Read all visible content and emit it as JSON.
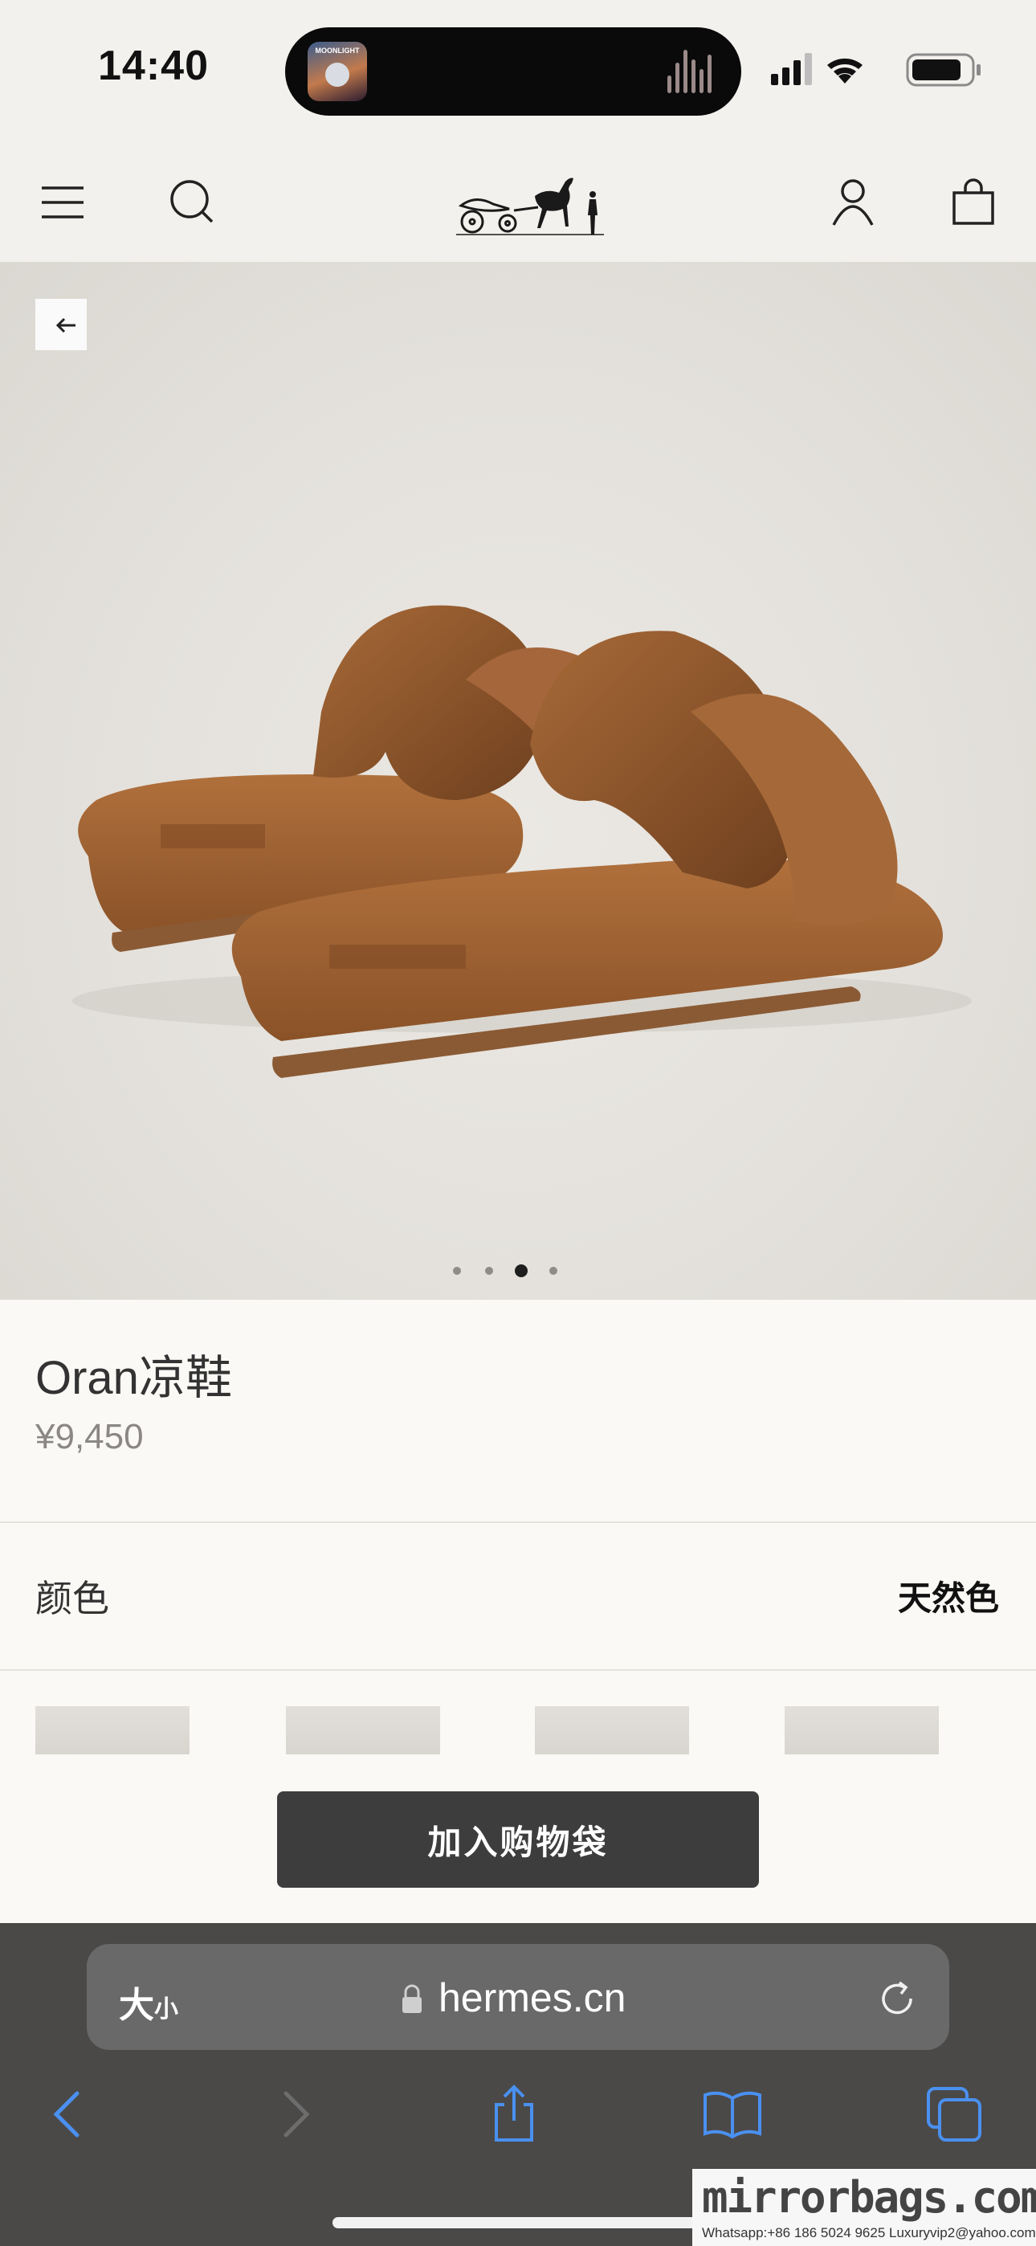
{
  "status_bar": {
    "time": "14:40",
    "now_playing_art_text": "MOONLIGHT"
  },
  "nav": {
    "menu_icon": "hamburger-menu-icon",
    "search_icon": "search-icon",
    "logo": "hermes-carriage-logo",
    "account_icon": "account-icon",
    "bag_icon": "shopping-bag-icon"
  },
  "gallery": {
    "back_icon": "arrow-left-icon",
    "image_count": 4,
    "active_index": 2
  },
  "product": {
    "name": "Oran凉鞋",
    "price": "¥9,450",
    "color_label": "颜色",
    "color_value": "天然色",
    "swatch_count": 4
  },
  "cta": {
    "add_to_bag": "加入购物袋"
  },
  "browser": {
    "text_size_big": "大",
    "text_size_small": "小",
    "url": "hermes.cn",
    "accent_color": "#4a90f0"
  },
  "watermark": {
    "main": "mirrorbags.com",
    "contact": "Whatsapp:+86 186 5024 9625   Luxuryvip2@yahoo.com"
  }
}
